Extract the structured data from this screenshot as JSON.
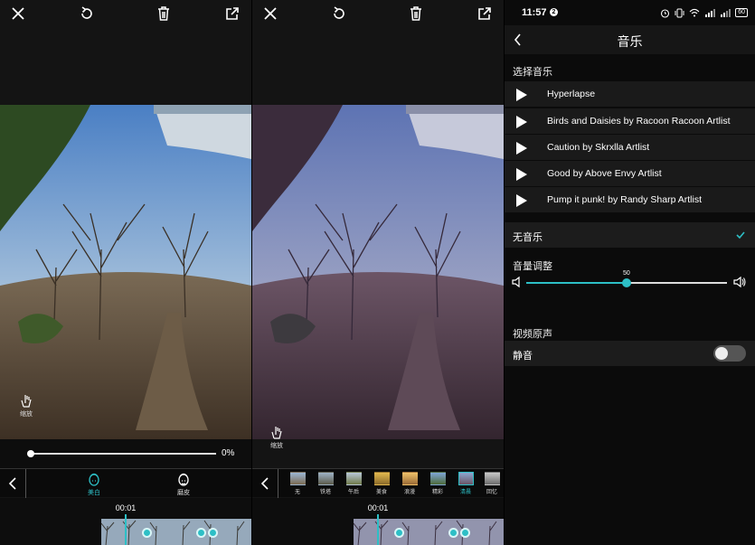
{
  "left_editor": {
    "zoom_hint_label": "缩放",
    "slider_value": "0%",
    "tools": [
      {
        "label": "美白",
        "active": true
      },
      {
        "label": "磨皮",
        "active": false
      }
    ],
    "timecode": "00:01"
  },
  "middle_editor": {
    "zoom_hint_label": "缩放",
    "filters": [
      {
        "label": "无",
        "active": false
      },
      {
        "label": "铁塔",
        "active": false
      },
      {
        "label": "午后",
        "active": false
      },
      {
        "label": "美食",
        "active": false
      },
      {
        "label": "浪漫",
        "active": false
      },
      {
        "label": "精彩",
        "active": false
      },
      {
        "label": "清晨",
        "active": true
      },
      {
        "label": "回忆",
        "active": false
      }
    ],
    "timecode": "00:01"
  },
  "music": {
    "status": {
      "time": "11:57",
      "notification_badge": "2",
      "battery": "60"
    },
    "title": "音乐",
    "select_section_label": "选择音乐",
    "tracks": [
      {
        "name": "Hyperlapse"
      },
      {
        "name": "Birds and Daisies by Racoon Racoon Artlist"
      },
      {
        "name": "Caution by Skrxlla Artlist"
      },
      {
        "name": "Good by Above Envy Artlist"
      },
      {
        "name": "Pump it punk! by Randy Sharp Artlist"
      }
    ],
    "no_music_label": "无音乐",
    "no_music_selected": true,
    "volume_label": "音量调整",
    "volume_value": "50",
    "volume_percent": 50,
    "original_audio_label": "视频原声",
    "mute_label": "静音",
    "mute_on": false
  },
  "colors": {
    "accent": "#2dbfc6",
    "panel_bg": "#141414"
  }
}
